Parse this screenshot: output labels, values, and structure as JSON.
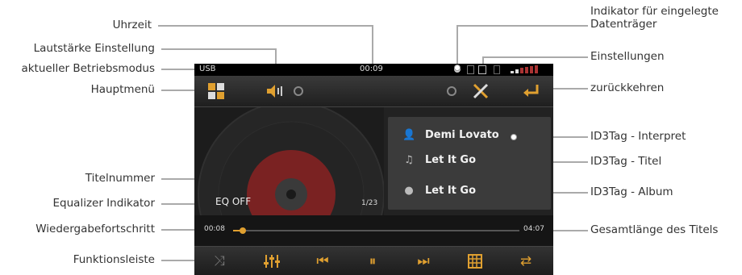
{
  "callouts_left": {
    "uhrzeit": "Uhrzeit",
    "lautstaerke": "Lautstärke Einstellung",
    "betriebsmodus": "aktueller Betriebsmodus",
    "hauptmenue": "Hauptmenü",
    "titelnummer": "Titelnummer",
    "equalizer": "Equalizer Indikator",
    "wiedergabe": "Wiedergabefortschritt",
    "funktionsleiste": "Funktionsleiste"
  },
  "callouts_right": {
    "datentraeger_1": "Indikator für eingelegte",
    "datentraeger_2": "Datenträger",
    "einstellungen": "Einstellungen",
    "zurueck": "zurückkehren",
    "interpret": "ID3Tag - Interpret",
    "titel": "ID3Tag - Titel",
    "album": "ID3Tag - Album",
    "gesamtlaenge": "Gesamtlänge des Titels"
  },
  "screen": {
    "status": {
      "mode": "USB",
      "time": "00:09"
    },
    "track_number": "1/23",
    "eq_indicator": "EQ OFF",
    "id3": {
      "artist": "Demi Lovato",
      "title": "Let It Go",
      "album": "Let It Go"
    },
    "elapsed": "00:08",
    "total": "04:07",
    "progress_fraction": 0.035
  },
  "colors": {
    "accent": "#e0a030",
    "background": "#1a1a1a"
  },
  "icons": {
    "top": [
      "main-menu-icon",
      "volume-icon",
      "settings-icon",
      "back-icon"
    ],
    "status": [
      "disc-icon",
      "sd-card-icon",
      "usb-icon",
      "signal-icon"
    ],
    "function_bar": [
      "shuffle-icon",
      "equalizer-icon",
      "previous-icon",
      "pause-icon",
      "next-icon",
      "list-icon",
      "repeat-icon"
    ]
  }
}
